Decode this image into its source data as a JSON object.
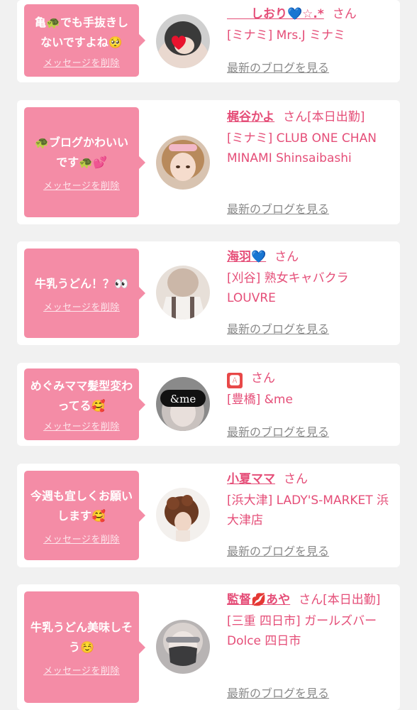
{
  "suffix": "さん",
  "delete_label": "メッセージを削除",
  "blog_label": "最新のブログを見る",
  "cards": [
    {
      "message": "亀🐢でも手抜きしないですよね🥺",
      "name": "　　しおり💙☆.*",
      "suffix": "さん",
      "shop": "[ミナミ] Mrs.J ミナミ"
    },
    {
      "message": "🐢ブログかわいいです🐢💕",
      "name": "梶谷かよ",
      "suffix": "さん[本日出勤]",
      "shop": "[ミナミ] CLUB ONE CHAN MINAMI Shinsaibashi"
    },
    {
      "message": "牛乳うどん！？👀",
      "name": "海羽💙",
      "suffix": "さん",
      "shop": "[刈谷] 熟女キャバクラ LOUVRE"
    },
    {
      "message": "めぐみママ髪型変わってる🥰",
      "name": "🅰",
      "suffix": "さん",
      "shop": "[豊橋] &me"
    },
    {
      "message": "今週も宜しくお願いします🥰",
      "name": "小夏ママ",
      "suffix": "さん",
      "shop": "[浜大津] LADY'S-MARKET 浜大津店"
    },
    {
      "message": "牛乳うどん美味しそう☺️",
      "name": "監督💋あや",
      "suffix": "さん[本日出勤]",
      "shop": "[三重 四日市] ガールズバー Dolce 四日市"
    }
  ],
  "colors": {
    "background": "#f1f1f1",
    "card": "#ffffff",
    "bubble": "#f48ca6",
    "accent_text": "#e54e78",
    "link_gray": "#8a8a8a"
  }
}
